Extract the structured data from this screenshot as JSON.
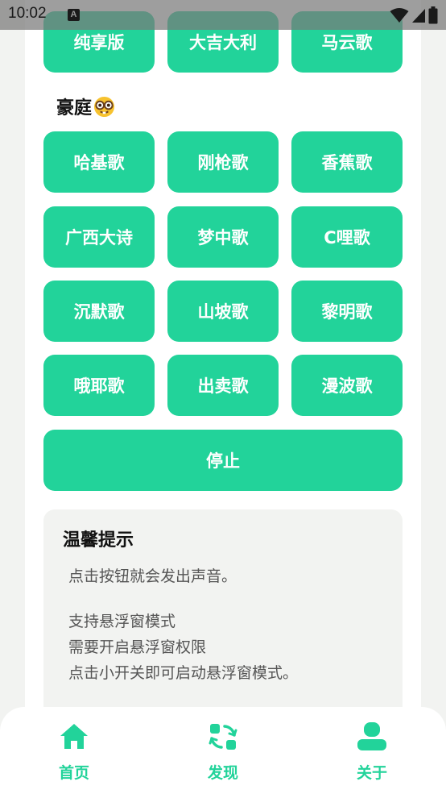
{
  "status_bar": {
    "time": "10:02",
    "app_icon_letter": "A"
  },
  "top_row": [
    "纯享版",
    "大吉大利",
    "马云歌"
  ],
  "section": {
    "title": "豪庭"
  },
  "grid": [
    [
      "哈基歌",
      "刚枪歌",
      "香蕉歌"
    ],
    [
      "广西大诗",
      "梦中歌",
      "C哩歌"
    ],
    [
      "沉默歌",
      "山坡歌",
      "黎明歌"
    ],
    [
      "哦耶歌",
      "出卖歌",
      "漫波歌"
    ]
  ],
  "stop_button": "停止",
  "tips": {
    "title": "温馨提示",
    "lines": [
      "点击按钮就会发出声音。",
      "支持悬浮窗模式",
      "需要开启悬浮窗权限",
      "点击小开关即可启动悬浮窗模式。"
    ]
  },
  "nav": [
    {
      "label": "首页",
      "icon": "home-icon"
    },
    {
      "label": "发现",
      "icon": "discover-icon"
    },
    {
      "label": "关于",
      "icon": "user-icon"
    }
  ],
  "colors": {
    "accent": "#22d39a",
    "background": "#f2f3f1",
    "card": "#ffffff"
  }
}
